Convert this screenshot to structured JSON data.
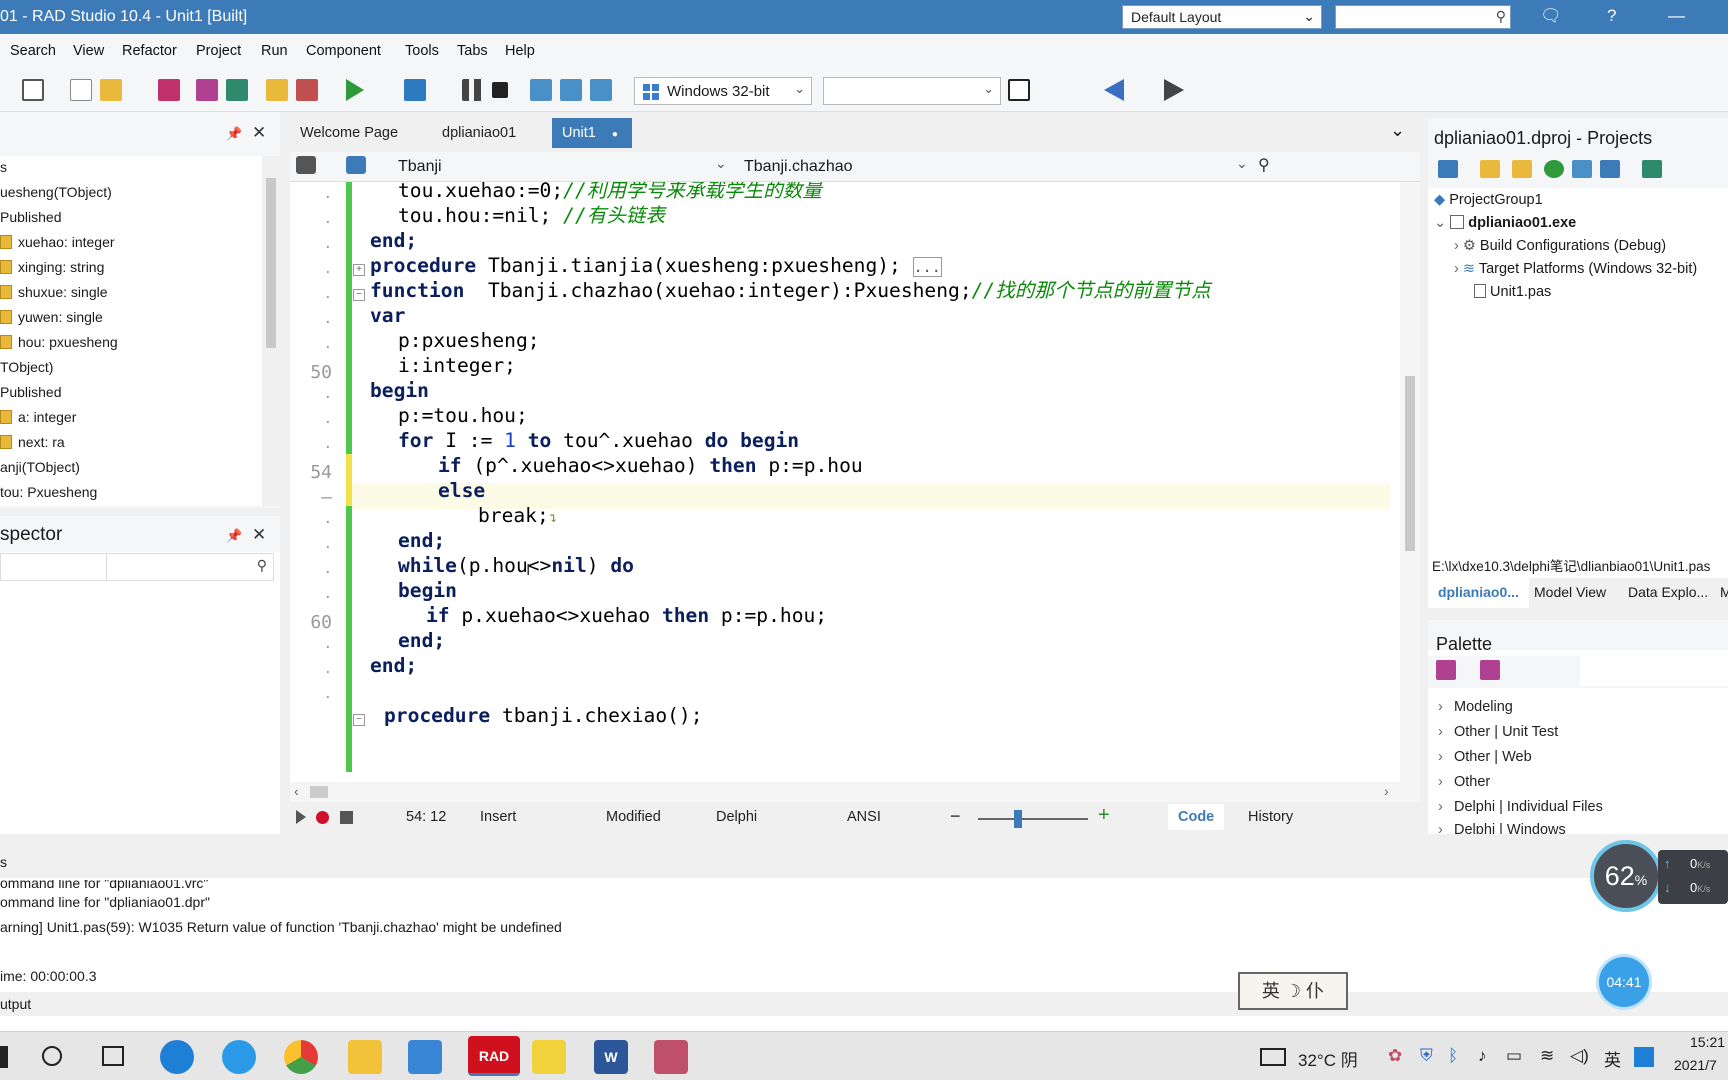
{
  "window": {
    "title": "01 - RAD Studio 10.4 - Unit1 [Built]",
    "layout_combo": "Default Layout"
  },
  "menu": [
    "Search",
    "View",
    "Refactor",
    "Project",
    "Run",
    "Component",
    "Tools",
    "Tabs",
    "Help"
  ],
  "toolbar": {
    "platform": "Windows 32-bit",
    "icons": [
      "view-icon",
      "new-file-icon",
      "open-icon",
      "save-icon",
      "save-all-icon",
      "open-project-icon",
      "add-file-icon",
      "remove-file-icon",
      "run-icon",
      "run-without-debug-icon",
      "pause-icon",
      "stop-icon",
      "step-over-icon",
      "trace-into-icon",
      "run-to-cursor-icon",
      "back-icon",
      "forward-icon"
    ]
  },
  "structure": {
    "nodes": [
      "s",
      "uesheng(TObject)",
      "Published",
      "xuehao: integer",
      "xinging: string",
      "shuxue: single",
      "yuwen: single",
      "hou: pxuesheng",
      "TObject)",
      "Published",
      "a: integer",
      "next: ra",
      "anji(TObject)",
      "tou: Pxuesheng"
    ]
  },
  "inspector": {
    "title": "spector"
  },
  "editor": {
    "tabs": [
      {
        "label": "Welcome Page"
      },
      {
        "label": "dplianiao01"
      },
      {
        "label": "Unit1"
      }
    ],
    "nav_class": "Tbanji",
    "nav_method": "Tbanji.chazhao",
    "line_numbers": {
      "l50": "50",
      "l54": "54",
      "l60": "60"
    },
    "code": [
      "tou.xuehao:=0;",
      "//利用学号来承载学生的数量",
      "tou.hou:=nil;",
      "//有头链表",
      "end;",
      "procedure",
      "Tbanji.tianjia(xuesheng:pxuesheng);",
      "...",
      "function",
      "Tbanji.chazhao(xuehao:integer):Pxuesheng;",
      "//找的那个节点的前置节点",
      "var",
      "p:pxuesheng;",
      "i:integer;",
      "begin",
      "p:=tou.hou;",
      "for",
      "I :=",
      "1",
      "to",
      "tou^.xuehao",
      "do begin",
      "if",
      "(p^.xuehao<>xuehao)",
      "then",
      "p:=p.hou",
      "else",
      "break;",
      "end;",
      "while",
      "(p.hou<>",
      "nil",
      ")",
      "do",
      "begin",
      "if",
      "p.xuehao<>xuehao",
      "then",
      "p:=p.hou;",
      "end;",
      "end;",
      "procedure",
      "tbanji.chexiao();"
    ]
  },
  "status": {
    "position": "54: 12",
    "mode": "Insert",
    "modified": "Modified",
    "language": "Delphi",
    "encoding": "ANSI",
    "code_tab": "Code",
    "history_tab": "History"
  },
  "projects": {
    "title": "dplianiao01.dproj - Projects",
    "tree": [
      "ProjectGroup1",
      "dplianiao01.exe",
      "Build Configurations (Debug)",
      "Target Platforms (Windows 32-bit)",
      "Unit1.pas"
    ],
    "path": "E:\\lx\\dxe10.3\\delphi笔记\\dlianbiao01\\Unit1.pas",
    "tabs": [
      "dplianiao0...",
      "Model View",
      "Data Explo...",
      "M"
    ]
  },
  "palette": {
    "title": "Palette",
    "items": [
      "Modeling",
      "Other | Unit Test",
      "Other | Web",
      "Other",
      "Delphi | Individual Files",
      "Delphi | Windows"
    ]
  },
  "messages": {
    "header": "s",
    "lines": [
      "ommand line for \"dplianiao01.vrc\"",
      "ommand line for \"dplianiao01.dpr\"",
      "arning] Unit1.pas(59): W1035 Return value of function 'Tbanji.chazhao' might be undefined",
      "ime: 00:00:00.3"
    ],
    "footer": "utput"
  },
  "overlay": {
    "perf_percent": "62",
    "perf_unit": "%",
    "net_up": "0",
    "net_down": "0",
    "net_unit": "K/s",
    "timer": "04:41",
    "ime": "英 ☽ 仆"
  },
  "taskbar": {
    "apps": [
      "start-icon",
      "cortana-icon",
      "task-view-icon",
      "edge-icon",
      "ie-icon",
      "chrome-icon",
      "file-explorer-icon",
      "feather-icon",
      "rad-studio-icon",
      "sticky-icon",
      "word-icon",
      "app-icon"
    ],
    "rad_label": "RAD",
    "word_label": "W",
    "weather": "32°C 阴",
    "ime_lang": "英",
    "time": "15:21",
    "date": "2021/7"
  },
  "colors": {
    "accent": "#3c7ab8",
    "keyword": "#0b1f5c",
    "comment": "#0a8a0a",
    "number": "#1a3fd0",
    "changebar": "#4cc84c"
  }
}
